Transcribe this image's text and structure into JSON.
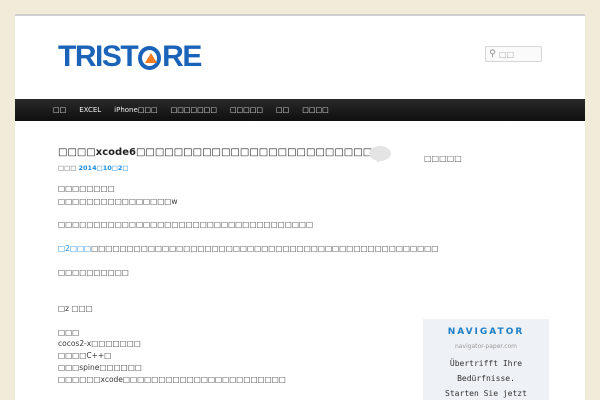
{
  "header": {
    "logo_left": "TRIST",
    "logo_right": "RE",
    "search_placeholder": "□□"
  },
  "nav": {
    "items": [
      "□□",
      "EXCEL",
      "iPhone□□□",
      "□□□□□□□",
      "□□□□□",
      "□□",
      "□□□□"
    ]
  },
  "post": {
    "title": "□□□□xcode6□□□□□□□□□□□□□□□□□□□□□□□□□",
    "meta_prefix": "□□□",
    "meta_date": "2014□10□2□",
    "lines": [
      "□□□□□□□□",
      "□□□□□□□□□□□□□□□□w",
      "□□□□□□□□□□□□□□□□□□□□□□□□□□□□□□□□□□□□",
      "□□□□□□□□□□□□□□□□□□□□□□□□□□□□□□□□□□□□□□□□□□□□□□□□□",
      "□□□□□□□□□□",
      "□z □□□",
      "□□□",
      "cocos2-x□□□□□□□",
      "□□□□C++□",
      "□□□spine□□□□□□",
      "□□□□□□xcode□□□□□□□□□□□□□□□□□□□□□□□"
    ],
    "link_prefix": "□2□□□"
  },
  "sidebar": {
    "title": "□□□□□",
    "ad_title": "NAVIGATOR",
    "ad_url": "navigator-paper.com",
    "ad_line1": "Übertrifft Ihre",
    "ad_line2": "Bedürfnisse.",
    "ad_line3": "Starten Sie jetzt"
  }
}
